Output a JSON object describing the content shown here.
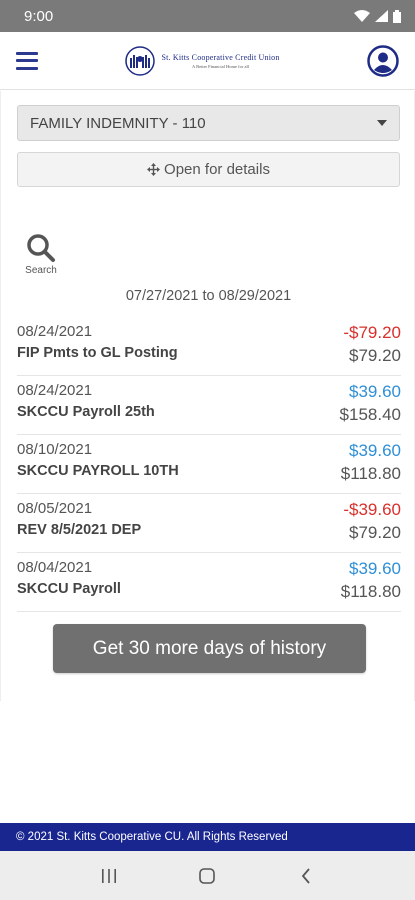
{
  "status_bar": {
    "time": "9:00"
  },
  "header": {
    "logo_name": "St. Kitts Cooperative Credit Union",
    "logo_tagline": "A Better Financial Home for all"
  },
  "account_select": {
    "selected": "FAMILY INDEMNITY - 110"
  },
  "details_button": {
    "label": "Open for details"
  },
  "search": {
    "label": "Search"
  },
  "date_range": "07/27/2021 to 08/29/2021",
  "colors": {
    "debit": "#d9302c",
    "credit": "#2f8fd6",
    "brand": "#1a2690"
  },
  "transactions": [
    {
      "date": "08/24/2021",
      "description": "FIP Pmts to GL Posting",
      "amount": "-$79.20",
      "balance": "$79.20",
      "type": "debit"
    },
    {
      "date": "08/24/2021",
      "description": "SKCCU Payroll 25th",
      "amount": "$39.60",
      "balance": "$158.40",
      "type": "credit"
    },
    {
      "date": "08/10/2021",
      "description": "SKCCU PAYROLL 10TH",
      "amount": "$39.60",
      "balance": "$118.80",
      "type": "credit"
    },
    {
      "date": "08/05/2021",
      "description": "REV 8/5/2021 DEP",
      "amount": "-$39.60",
      "balance": "$79.20",
      "type": "debit"
    },
    {
      "date": "08/04/2021",
      "description": "SKCCU Payroll",
      "amount": "$39.60",
      "balance": "$118.80",
      "type": "credit"
    }
  ],
  "more_button": {
    "label": "Get 30 more days of history"
  },
  "footer": {
    "text": "© 2021 St. Kitts Cooperative CU. All Rights Reserved"
  }
}
